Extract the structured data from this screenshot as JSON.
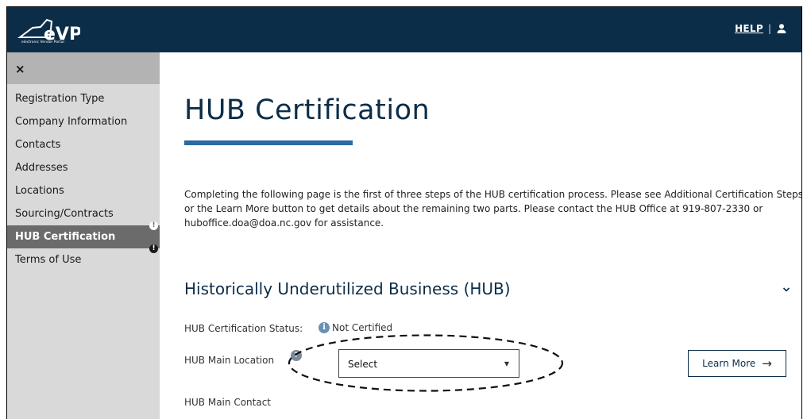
{
  "header": {
    "logo_text": "electronic Vendor Portal",
    "logo_mark": "eVP",
    "help_label": "HELP",
    "separator": "|",
    "background_color": "#0c2d48"
  },
  "sidebar": {
    "close_icon": "×",
    "items": [
      {
        "label": "Registration Type",
        "alert": false,
        "active": false
      },
      {
        "label": "Company Information",
        "alert": false,
        "active": false
      },
      {
        "label": "Contacts",
        "alert": false,
        "active": false
      },
      {
        "label": "Addresses",
        "alert": false,
        "active": false
      },
      {
        "label": "Locations",
        "alert": false,
        "active": false
      },
      {
        "label": "Sourcing/Contracts",
        "alert": false,
        "active": false
      },
      {
        "label": "HUB Certification",
        "alert": true,
        "active": true
      },
      {
        "label": "Terms of Use",
        "alert": true,
        "active": false
      }
    ],
    "alert_glyph": "!"
  },
  "main": {
    "title": "HUB Certification",
    "intro": "Completing the following page is the first of three steps of the HUB certification process. Please see Additional Certification Steps or the Learn More button to get details about the remaining two parts. Please contact the HUB Office at 919-807-2330 or huboffice.doa@doa.nc.gov for assistance.",
    "section_title": "Historically Underutilized Business (HUB)",
    "status_label": "HUB Certification Status:",
    "status_value": "Not Certified",
    "info_glyph": "i",
    "location_label": "HUB Main Location",
    "location_select_value": "Select",
    "location_help_glyph": "?",
    "learn_more_label": "Learn More",
    "learn_more_arrow": "→",
    "contact_label": "HUB Main Contact",
    "accent_color": "#2b6aa2"
  }
}
